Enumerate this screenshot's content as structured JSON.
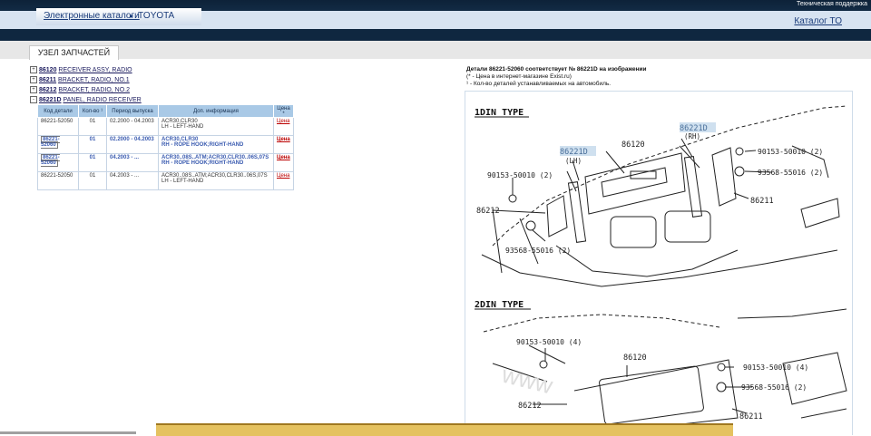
{
  "header": {
    "support_label": "Техническая поддержка",
    "breadcrumb_catalogs": "Электронные каталоги",
    "breadcrumb_separator": "▸",
    "breadcrumb_current": "TOYOTA",
    "to_catalog_label": "Каталог ТО"
  },
  "section_tab": "УЗЕЛ ЗАПЧАСТЕЙ",
  "tree": [
    {
      "toggle": "+",
      "code": "86120",
      "name": "RECEIVER ASSY, RADIO"
    },
    {
      "toggle": "+",
      "code": "86211",
      "name": "BRACKET, RADIO, NO.1"
    },
    {
      "toggle": "+",
      "code": "86212",
      "name": "BRACKET, RADIO, NO.2"
    },
    {
      "toggle": "-",
      "code": "86221D",
      "name": "PANEL, RADIO RECEIVER"
    }
  ],
  "table": {
    "headers": [
      "Код детали",
      "Кол-во ¹",
      "Период выпуска",
      "Доп. информация",
      "Цена *"
    ],
    "rows": [
      {
        "code": "86221-52050",
        "qty": "01",
        "period": "02.2000 - 04.2003",
        "info1": "ACR30,CLR30",
        "info2": "LH - LEFT-HAND",
        "price": "Цена"
      },
      {
        "code": "86221-52060",
        "qty": "01",
        "period": "02.2000 - 04.2003",
        "info1": "ACR30,CLR30",
        "info2": "RH - ROPE HOOK;RIGHT-HAND",
        "price": "Цена"
      },
      {
        "code": "86221-52060",
        "qty": "01",
        "period": "04.2003 - ...",
        "info1": "ACR30..08S..ATM;ACR30,CLR30..06S,07S",
        "info2": "RH - ROPE HOOK;RIGHT-HAND",
        "price": "Цена"
      },
      {
        "code": "86221-52050",
        "qty": "01",
        "period": "04.2003 - ...",
        "info1": "ACR30..08S..ATM;ACR30,CLR30..06S,07S",
        "info2": "LH - LEFT-HAND",
        "price": "Цена"
      }
    ]
  },
  "info": {
    "line1": "Детали 86221-52060 соответствует № 86221D на изображении",
    "line2": "(* - Цена в интернет-магазине Exist.ru)",
    "line3": "¹ - Кол-во деталей устанавливаемых на автомобиль."
  },
  "diagram": {
    "section1_title": "1DIN TYPE",
    "section2_title": "2DIN TYPE",
    "labels1": {
      "p86221d_lh": "86221D",
      "lh": "(LH)",
      "p86120": "86120",
      "p86221d_rh": "86221D",
      "rh": "(RH)",
      "screw_r": "90153-50010 (2)",
      "clip_r": "93568-55016 (2)",
      "p86211": "86211",
      "screw_l": "90153-50010 (2)",
      "p86212": "86212",
      "clip_l": "93568-55016 (2)"
    },
    "labels2": {
      "screw_l": "90153-50010 (4)",
      "p86120": "86120",
      "screw_r": "90153-50010 (4)",
      "clip_r": "93568-55016 (2)",
      "p86212": "86212",
      "p86211": "86211"
    }
  }
}
